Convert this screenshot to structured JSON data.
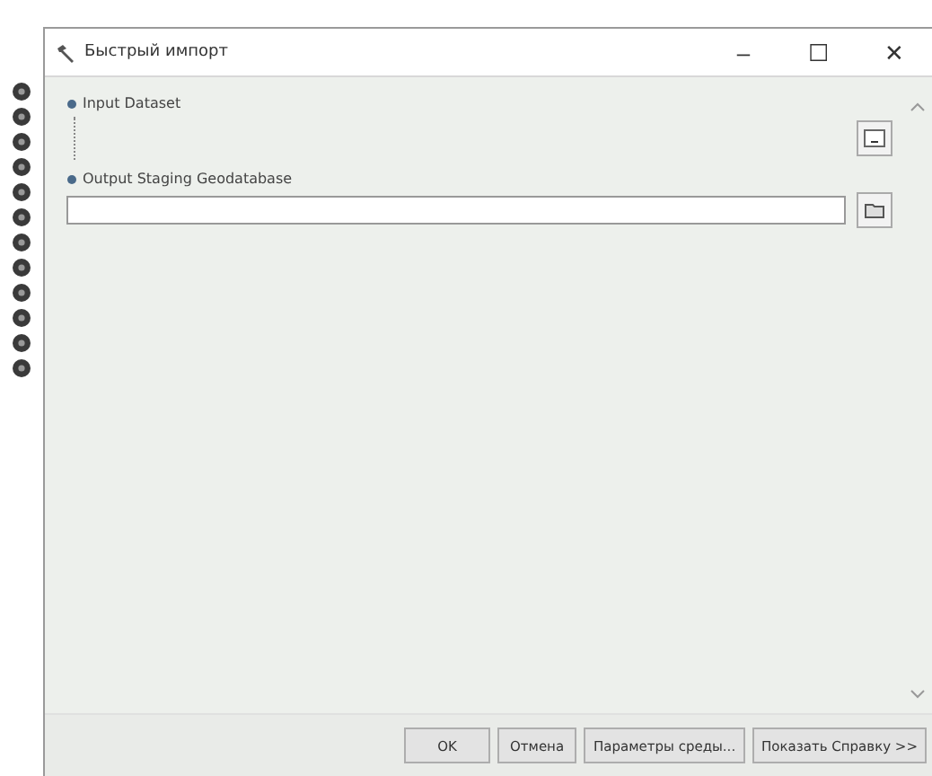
{
  "window": {
    "title": "Быстрый импорт",
    "controls": [
      "–",
      "☐",
      "✕"
    ]
  },
  "parameters": [
    {
      "label": "Input Dataset",
      "kind": "list"
    },
    {
      "label": "Output Staging Geodatabase",
      "kind": "text"
    }
  ],
  "buttons": [
    "OK",
    "Отмена",
    "Параметры среды...",
    "Показать Справку >>"
  ]
}
